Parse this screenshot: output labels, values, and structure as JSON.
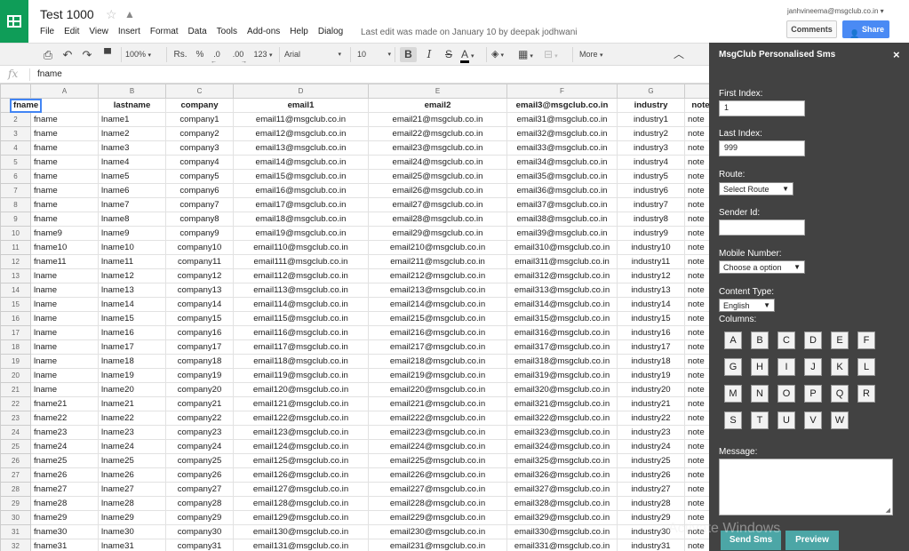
{
  "doc": {
    "title": "Test 1000",
    "last_edit": "Last edit was made on January 10 by deepak jodhwani"
  },
  "user": {
    "email": "janhvineema@msgclub.co.in",
    "email_caret": "▾"
  },
  "header": {
    "comments_label": "Comments",
    "share_label": "Share"
  },
  "menu": [
    "File",
    "Edit",
    "View",
    "Insert",
    "Format",
    "Data",
    "Tools",
    "Add-ons",
    "Help",
    "Dialog"
  ],
  "toolbar": {
    "zoom": "100%",
    "currency": "Rs.",
    "percent": "%",
    "dec_less": ".0",
    "dec_more": ".00",
    "numfmt": "123",
    "font": "Arial",
    "font_size": "10",
    "bold": "B",
    "italic": "I",
    "strike": "S",
    "text_color": "A",
    "more": "More"
  },
  "formula": {
    "fx": "fx",
    "value": "fname"
  },
  "grid": {
    "col_letters": [
      "A",
      "B",
      "C",
      "D",
      "E",
      "F",
      "G",
      ""
    ],
    "headers": [
      "fname",
      "lastname",
      "company",
      "email1",
      "email2",
      "email3@msgclub.co.in",
      "industry",
      "note"
    ],
    "rows": [
      [
        "fname",
        "lname1",
        "company1",
        "email11@msgclub.co.in",
        "email21@msgclub.co.in",
        "email31@msgclub.co.in",
        "industry1",
        "note"
      ],
      [
        "fname",
        "lname2",
        "company2",
        "email12@msgclub.co.in",
        "email22@msgclub.co.in",
        "email32@msgclub.co.in",
        "industry2",
        "note"
      ],
      [
        "fname",
        "lname3",
        "company3",
        "email13@msgclub.co.in",
        "email23@msgclub.co.in",
        "email33@msgclub.co.in",
        "industry3",
        "note"
      ],
      [
        "fname",
        "lname4",
        "company4",
        "email14@msgclub.co.in",
        "email24@msgclub.co.in",
        "email34@msgclub.co.in",
        "industry4",
        "note"
      ],
      [
        "fname",
        "lname5",
        "company5",
        "email15@msgclub.co.in",
        "email25@msgclub.co.in",
        "email35@msgclub.co.in",
        "industry5",
        "note"
      ],
      [
        "fname",
        "lname6",
        "company6",
        "email16@msgclub.co.in",
        "email26@msgclub.co.in",
        "email36@msgclub.co.in",
        "industry6",
        "note"
      ],
      [
        "fname",
        "lname7",
        "company7",
        "email17@msgclub.co.in",
        "email27@msgclub.co.in",
        "email37@msgclub.co.in",
        "industry7",
        "note"
      ],
      [
        "fname",
        "lname8",
        "company8",
        "email18@msgclub.co.in",
        "email28@msgclub.co.in",
        "email38@msgclub.co.in",
        "industry8",
        "note"
      ],
      [
        "fname9",
        "lname9",
        "company9",
        "email19@msgclub.co.in",
        "email29@msgclub.co.in",
        "email39@msgclub.co.in",
        "industry9",
        "note"
      ],
      [
        "fname10",
        "lname10",
        "company10",
        "email110@msgclub.co.in",
        "email210@msgclub.co.in",
        "email310@msgclub.co.in",
        "industry10",
        "note"
      ],
      [
        "fname11",
        "lname11",
        "company11",
        "email111@msgclub.co.in",
        "email211@msgclub.co.in",
        "email311@msgclub.co.in",
        "industry11",
        "note"
      ],
      [
        "lname",
        "lname12",
        "company12",
        "email112@msgclub.co.in",
        "email212@msgclub.co.in",
        "email312@msgclub.co.in",
        "industry12",
        "note"
      ],
      [
        "lname",
        "lname13",
        "company13",
        "email113@msgclub.co.in",
        "email213@msgclub.co.in",
        "email313@msgclub.co.in",
        "industry13",
        "note"
      ],
      [
        "lname",
        "lname14",
        "company14",
        "email114@msgclub.co.in",
        "email214@msgclub.co.in",
        "email314@msgclub.co.in",
        "industry14",
        "note"
      ],
      [
        "lname",
        "lname15",
        "company15",
        "email115@msgclub.co.in",
        "email215@msgclub.co.in",
        "email315@msgclub.co.in",
        "industry15",
        "note"
      ],
      [
        "lname",
        "lname16",
        "company16",
        "email116@msgclub.co.in",
        "email216@msgclub.co.in",
        "email316@msgclub.co.in",
        "industry16",
        "note"
      ],
      [
        "lname",
        "lname17",
        "company17",
        "email117@msgclub.co.in",
        "email217@msgclub.co.in",
        "email317@msgclub.co.in",
        "industry17",
        "note"
      ],
      [
        "lname",
        "lname18",
        "company18",
        "email118@msgclub.co.in",
        "email218@msgclub.co.in",
        "email318@msgclub.co.in",
        "industry18",
        "note"
      ],
      [
        "lname",
        "lname19",
        "company19",
        "email119@msgclub.co.in",
        "email219@msgclub.co.in",
        "email319@msgclub.co.in",
        "industry19",
        "note"
      ],
      [
        "lname",
        "lname20",
        "company20",
        "email120@msgclub.co.in",
        "email220@msgclub.co.in",
        "email320@msgclub.co.in",
        "industry20",
        "note"
      ],
      [
        "fname21",
        "lname21",
        "company21",
        "email121@msgclub.co.in",
        "email221@msgclub.co.in",
        "email321@msgclub.co.in",
        "industry21",
        "note"
      ],
      [
        "fname22",
        "lname22",
        "company22",
        "email122@msgclub.co.in",
        "email222@msgclub.co.in",
        "email322@msgclub.co.in",
        "industry22",
        "note"
      ],
      [
        "fname23",
        "lname23",
        "company23",
        "email123@msgclub.co.in",
        "email223@msgclub.co.in",
        "email323@msgclub.co.in",
        "industry23",
        "note"
      ],
      [
        "fname24",
        "lname24",
        "company24",
        "email124@msgclub.co.in",
        "email224@msgclub.co.in",
        "email324@msgclub.co.in",
        "industry24",
        "note"
      ],
      [
        "fname25",
        "lname25",
        "company25",
        "email125@msgclub.co.in",
        "email225@msgclub.co.in",
        "email325@msgclub.co.in",
        "industry25",
        "note"
      ],
      [
        "fname26",
        "lname26",
        "company26",
        "email126@msgclub.co.in",
        "email226@msgclub.co.in",
        "email326@msgclub.co.in",
        "industry26",
        "note"
      ],
      [
        "fname27",
        "lname27",
        "company27",
        "email127@msgclub.co.in",
        "email227@msgclub.co.in",
        "email327@msgclub.co.in",
        "industry27",
        "note"
      ],
      [
        "fname28",
        "lname28",
        "company28",
        "email128@msgclub.co.in",
        "email228@msgclub.co.in",
        "email328@msgclub.co.in",
        "industry28",
        "note"
      ],
      [
        "fname29",
        "lname29",
        "company29",
        "email129@msgclub.co.in",
        "email229@msgclub.co.in",
        "email329@msgclub.co.in",
        "industry29",
        "note"
      ],
      [
        "fname30",
        "lname30",
        "company30",
        "email130@msgclub.co.in",
        "email230@msgclub.co.in",
        "email330@msgclub.co.in",
        "industry30",
        "note"
      ],
      [
        "fname31",
        "lname31",
        "company31",
        "email131@msgclub.co.in",
        "email231@msgclub.co.in",
        "email331@msgclub.co.in",
        "industry31",
        "note"
      ]
    ]
  },
  "sidebar": {
    "title": "MsgClub Personalised Sms",
    "close": "×",
    "first_index_label": "First Index:",
    "first_index_value": "1",
    "last_index_label": "Last Index:",
    "last_index_value": "999",
    "route_label": "Route:",
    "route_value": "Select Route",
    "sender_label": "Sender Id:",
    "sender_value": "",
    "mobile_label": "Mobile Number:",
    "mobile_value": "Choose a option",
    "content_type_label": "Content Type:",
    "content_type_value": "English",
    "columns_label": "Columns:",
    "columns": [
      "A",
      "B",
      "C",
      "D",
      "E",
      "F",
      "G",
      "H",
      "I",
      "J",
      "K",
      "L",
      "M",
      "N",
      "O",
      "P",
      "Q",
      "R",
      "S",
      "T",
      "U",
      "V",
      "W"
    ],
    "message_label": "Message:",
    "send_label": "Send Sms",
    "preview_label": "Preview"
  },
  "watermark": "Activate Windows",
  "icons": {
    "print": "print-icon",
    "undo": "undo-icon",
    "redo": "redo-icon",
    "paint": "paint-format-icon",
    "fill": "fill-color-icon",
    "borders": "borders-icon",
    "merge": "merge-icon",
    "collapse": "collapse-icon"
  },
  "colors": {
    "sheets_green": "#0f9d58",
    "share_blue": "#4a8af4",
    "sidebar_bg": "#424242",
    "button_teal": "#4ca6a6"
  }
}
